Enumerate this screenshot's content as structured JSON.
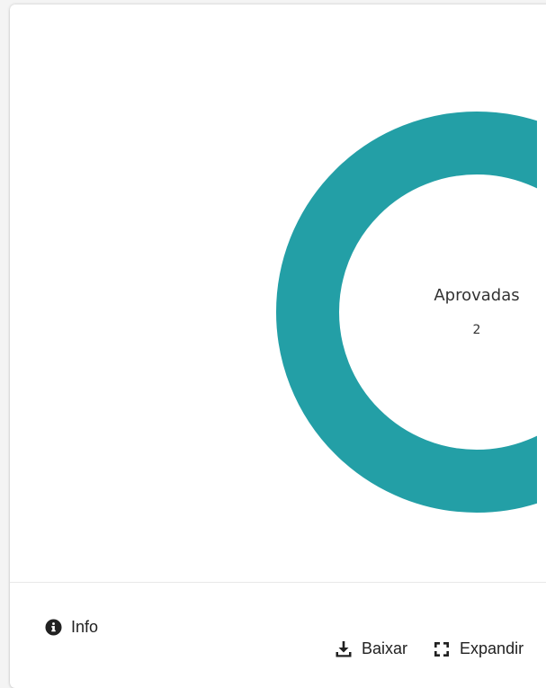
{
  "chart_data": {
    "type": "pie",
    "style": "donut",
    "slices": [
      {
        "label": "Aprovadas",
        "value": 2,
        "color": "#239fa6"
      }
    ],
    "center_label": "Aprovadas",
    "center_value": "2"
  },
  "footer": {
    "info_label": "Info",
    "download_label": "Baixar",
    "expand_label": "Expandir"
  },
  "colors": {
    "ring": "#239fa6",
    "card": "#ffffff",
    "background": "#f4f4f4"
  },
  "icons": {
    "info": "info-circle-icon",
    "download": "download-icon",
    "expand": "expand-icon"
  }
}
